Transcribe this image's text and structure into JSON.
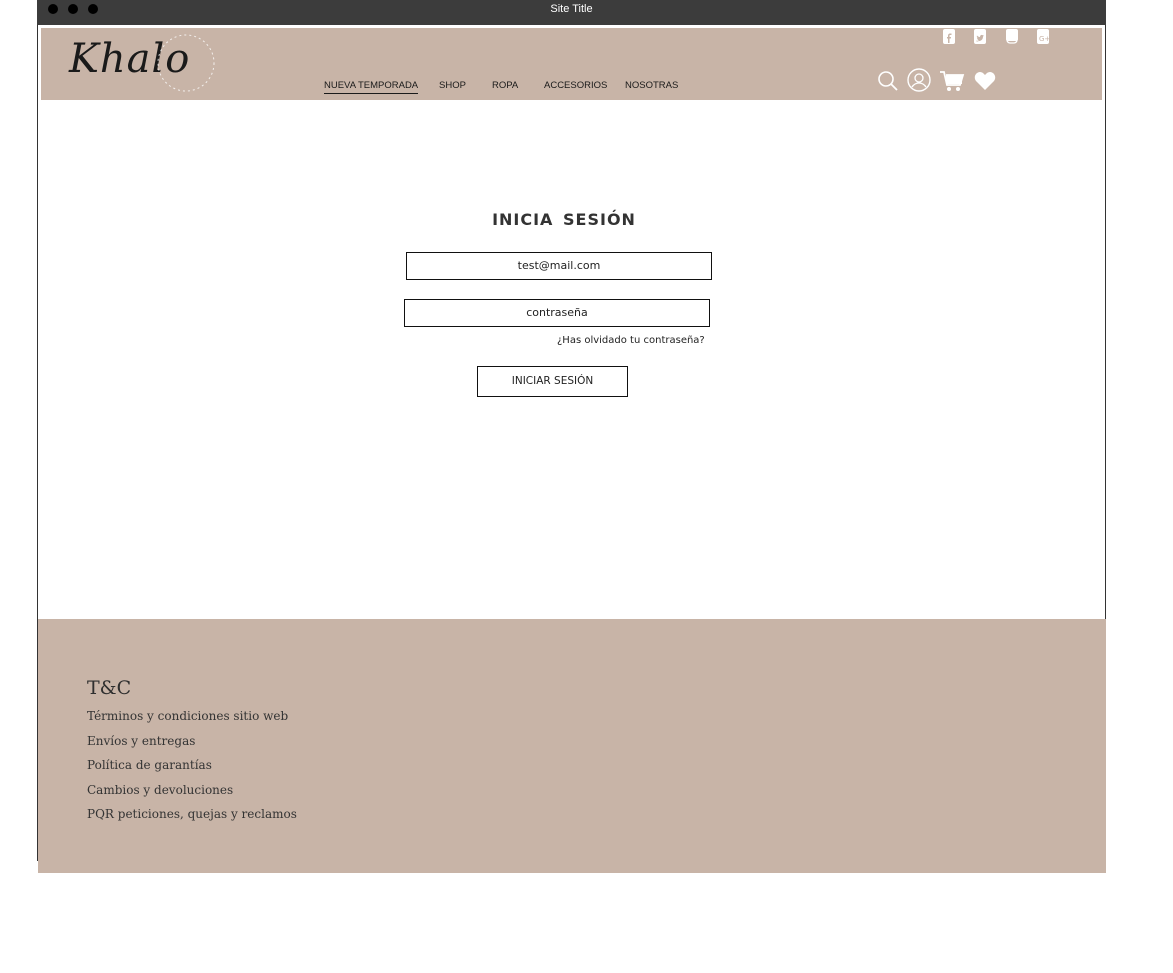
{
  "window": {
    "title": "Site Title"
  },
  "header": {
    "logo_text": "Khalo",
    "nav": [
      {
        "label": "NUEVA TEMPORADA",
        "active": true
      },
      {
        "label": "SHOP"
      },
      {
        "label": "ROPA"
      },
      {
        "label": "ACCESORIOS"
      },
      {
        "label": "NOSOTRAS"
      }
    ],
    "social_icons": [
      "facebook-icon",
      "twitter-icon",
      "instagram-icon",
      "google-plus-icon"
    ],
    "action_icons": [
      "search-icon",
      "user-icon",
      "cart-icon",
      "heart-icon"
    ],
    "background": "#c8b4a7"
  },
  "login": {
    "title": "INICIA  SESIÓN",
    "email_value": "test@mail.com",
    "password_placeholder": "contraseña",
    "forgot_link": "¿Has olvidado tu contraseña?",
    "submit_label": "INICIAR SESIÓN"
  },
  "footer": {
    "title": "T&C",
    "links": [
      "Términos y condiciones sitio web",
      "Envíos y entregas",
      "Política de garantías",
      "Cambios y devoluciones",
      "PQR peticiones, quejas y reclamos"
    ],
    "background": "#c8b4a7"
  }
}
